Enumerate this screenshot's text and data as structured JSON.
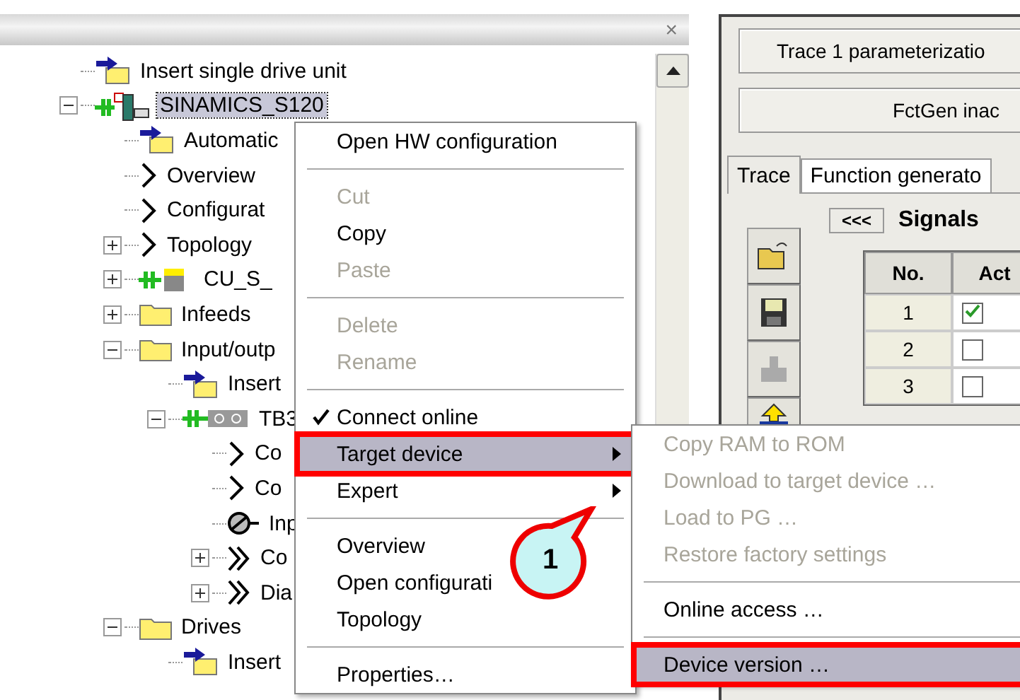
{
  "left_pane": {
    "close": "×",
    "tree": [
      {
        "label": "Insert single drive unit",
        "kind": "insert",
        "selected": false
      },
      {
        "label": "SINAMICS_S120",
        "kind": "device",
        "selected": true,
        "expanded": true,
        "children": [
          {
            "label": "Automatic",
            "kind": "insert",
            "selected": false
          },
          {
            "label": "Overview",
            "kind": "arrow",
            "selected": false
          },
          {
            "label": "Configurat",
            "kind": "arrow",
            "selected": false
          },
          {
            "label": "Topology",
            "kind": "arrow",
            "selected": false,
            "expanded": false
          },
          {
            "label": "CU_S_",
            "kind": "cu",
            "selected": false,
            "expanded": false
          },
          {
            "label": "Infeeds",
            "kind": "folder",
            "selected": false,
            "expanded": false
          },
          {
            "label": "Input/outp",
            "kind": "folder",
            "selected": false,
            "expanded": true,
            "children": [
              {
                "label": "Insert",
                "kind": "insert",
                "selected": false
              },
              {
                "label": "TB3",
                "kind": "terminal",
                "selected": false,
                "expanded": true,
                "children": [
                  {
                    "label": "Co",
                    "kind": "arrow",
                    "selected": false
                  },
                  {
                    "label": "Co",
                    "kind": "arrow",
                    "selected": false
                  },
                  {
                    "label": "Inp",
                    "kind": "probe",
                    "selected": false
                  },
                  {
                    "label": "Co",
                    "kind": "double-arrow",
                    "selected": false,
                    "expanded": false
                  },
                  {
                    "label": "Dia",
                    "kind": "double-arrow",
                    "selected": false,
                    "expanded": false
                  }
                ]
              }
            ]
          },
          {
            "label": "Drives",
            "kind": "folder",
            "selected": false,
            "expanded": true,
            "children": [
              {
                "label": "Insert",
                "kind": "insert",
                "selected": false
              }
            ]
          }
        ]
      }
    ]
  },
  "right_pane": {
    "trace_status": "Trace 1 parameterizatio",
    "fctgen_status": "FctGen inac",
    "tabs": [
      {
        "label": "Trace",
        "selected": true
      },
      {
        "label": "Function generato",
        "selected": false
      }
    ],
    "collapse_button": "<<<",
    "signals_title": "Signals",
    "tools": [
      {
        "kind": "open"
      },
      {
        "kind": "save"
      },
      {
        "kind": "disabled"
      },
      {
        "kind": "upload"
      }
    ],
    "table": {
      "columns": [
        "No.",
        "Act"
      ],
      "rows": [
        {
          "no": "1",
          "active": true
        },
        {
          "no": "2",
          "active": false
        },
        {
          "no": "3",
          "active": false
        }
      ]
    }
  },
  "context_menu": [
    {
      "kind": "item",
      "label": "Open HW configuration",
      "disabled": false,
      "checked": false,
      "submenu": false,
      "selected": false,
      "outlined": false
    },
    {
      "kind": "separator"
    },
    {
      "kind": "item",
      "label": "Cut",
      "disabled": true,
      "checked": false,
      "submenu": false,
      "selected": false,
      "outlined": false
    },
    {
      "kind": "item",
      "label": "Copy",
      "disabled": false,
      "checked": false,
      "submenu": false,
      "selected": false,
      "outlined": false
    },
    {
      "kind": "item",
      "label": "Paste",
      "disabled": true,
      "checked": false,
      "submenu": false,
      "selected": false,
      "outlined": false
    },
    {
      "kind": "separator"
    },
    {
      "kind": "item",
      "label": "Delete",
      "disabled": true,
      "checked": false,
      "submenu": false,
      "selected": false,
      "outlined": false
    },
    {
      "kind": "item",
      "label": "Rename",
      "disabled": true,
      "checked": false,
      "submenu": false,
      "selected": false,
      "outlined": false
    },
    {
      "kind": "separator"
    },
    {
      "kind": "item",
      "label": "Connect online",
      "disabled": false,
      "checked": true,
      "submenu": false,
      "selected": false,
      "outlined": false
    },
    {
      "kind": "item",
      "label": "Target device",
      "disabled": false,
      "checked": false,
      "submenu": true,
      "selected": true,
      "outlined": true
    },
    {
      "kind": "item",
      "label": "Expert",
      "disabled": false,
      "checked": false,
      "submenu": true,
      "selected": false,
      "outlined": false
    },
    {
      "kind": "separator"
    },
    {
      "kind": "item",
      "label": "Overview",
      "disabled": false,
      "checked": false,
      "submenu": false,
      "selected": false,
      "outlined": false
    },
    {
      "kind": "item",
      "label": "Open configurati",
      "disabled": false,
      "checked": false,
      "submenu": false,
      "selected": false,
      "outlined": false
    },
    {
      "kind": "item",
      "label": "Topology",
      "disabled": false,
      "checked": false,
      "submenu": false,
      "selected": false,
      "outlined": false
    },
    {
      "kind": "separator"
    },
    {
      "kind": "item",
      "label": "Properties…",
      "disabled": false,
      "checked": false,
      "submenu": false,
      "selected": false,
      "outlined": false
    }
  ],
  "submenu": [
    {
      "kind": "item",
      "label": "Copy RAM to ROM",
      "disabled": true,
      "selected": false,
      "outlined": false
    },
    {
      "kind": "item",
      "label": "Download to target device …",
      "disabled": true,
      "selected": false,
      "outlined": false
    },
    {
      "kind": "item",
      "label": "Load to PG …",
      "disabled": true,
      "selected": false,
      "outlined": false
    },
    {
      "kind": "item",
      "label": "Restore factory settings",
      "disabled": true,
      "selected": false,
      "outlined": false
    },
    {
      "kind": "separator"
    },
    {
      "kind": "item",
      "label": "Online access …",
      "disabled": false,
      "selected": false,
      "outlined": false
    },
    {
      "kind": "separator"
    },
    {
      "kind": "item",
      "label": "Device version …",
      "disabled": false,
      "selected": true,
      "outlined": true
    }
  ],
  "callout": {
    "label": "1"
  }
}
